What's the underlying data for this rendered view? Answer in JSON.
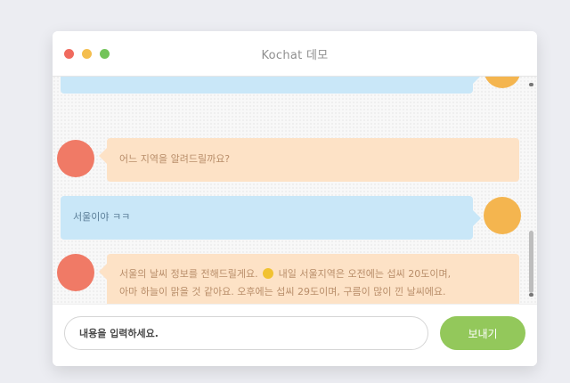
{
  "window": {
    "title": "Kochat 데모"
  },
  "messages": [
    {
      "sender": "user",
      "text": "",
      "note": "partially scrolled-out message"
    },
    {
      "sender": "bot",
      "text": "어느 지역을 알려드릴까요?"
    },
    {
      "sender": "user",
      "text": "서울이야 ㅋㅋ"
    },
    {
      "sender": "bot",
      "text_a": "서울의 날씨 정보를 전해드릴게요.",
      "emoji": "smiley",
      "text_b": "내일 서울지역은 오전에는 섭씨 20도이며,",
      "text_c": "아마 하늘이 맑을 것 같아요. 오후에는 섭씨 29도이며, 구름이 많이 낀 날씨에요."
    }
  ],
  "input": {
    "placeholder": "내용을 입력하세요."
  },
  "send_button": {
    "label": "보내기"
  },
  "colors": {
    "user_bubble": "#c9e7f8",
    "bot_bubble": "#fde2c6",
    "bot_avatar": "#f07a66",
    "user_avatar": "#f4b54f",
    "send_button": "#93c85b"
  }
}
